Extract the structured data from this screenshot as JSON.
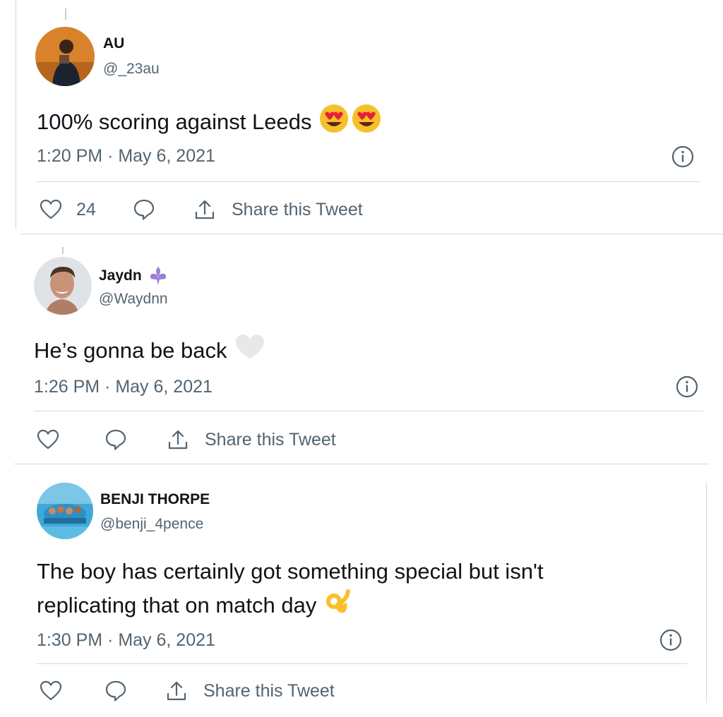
{
  "tweets": [
    {
      "display_name": "AU",
      "handle": "@_23au",
      "text": "100% scoring against Leeds",
      "text_emoji": "smiling-face-with-heart-eyes x2",
      "timestamp": "1:20 PM · May 6, 2021",
      "like_count": "24",
      "share_label": "Share this Tweet"
    },
    {
      "display_name": "Jaydn",
      "name_badge": "fleur-de-lis",
      "handle": "@Waydnn",
      "text": "He’s gonna be back",
      "text_emoji": "white-heart",
      "timestamp": "1:26 PM · May 6, 2021",
      "like_count": "",
      "share_label": "Share this Tweet"
    },
    {
      "display_name": "BENJI THORPE",
      "handle": "@benji_4pence",
      "text_line1": "The boy has certainly got something special but isn't",
      "text_line2": "replicating that on match day",
      "text_emoji": "ok-hand",
      "timestamp": "1:30 PM · May 6, 2021",
      "like_count": "",
      "share_label": "Share this Tweet"
    }
  ],
  "colors": {
    "text": "#0f1419",
    "secondary": "#536471",
    "divider": "#cfd9de",
    "fleur_purple": "#9b7fd6",
    "emoji_yellow": "#f7c02b"
  }
}
